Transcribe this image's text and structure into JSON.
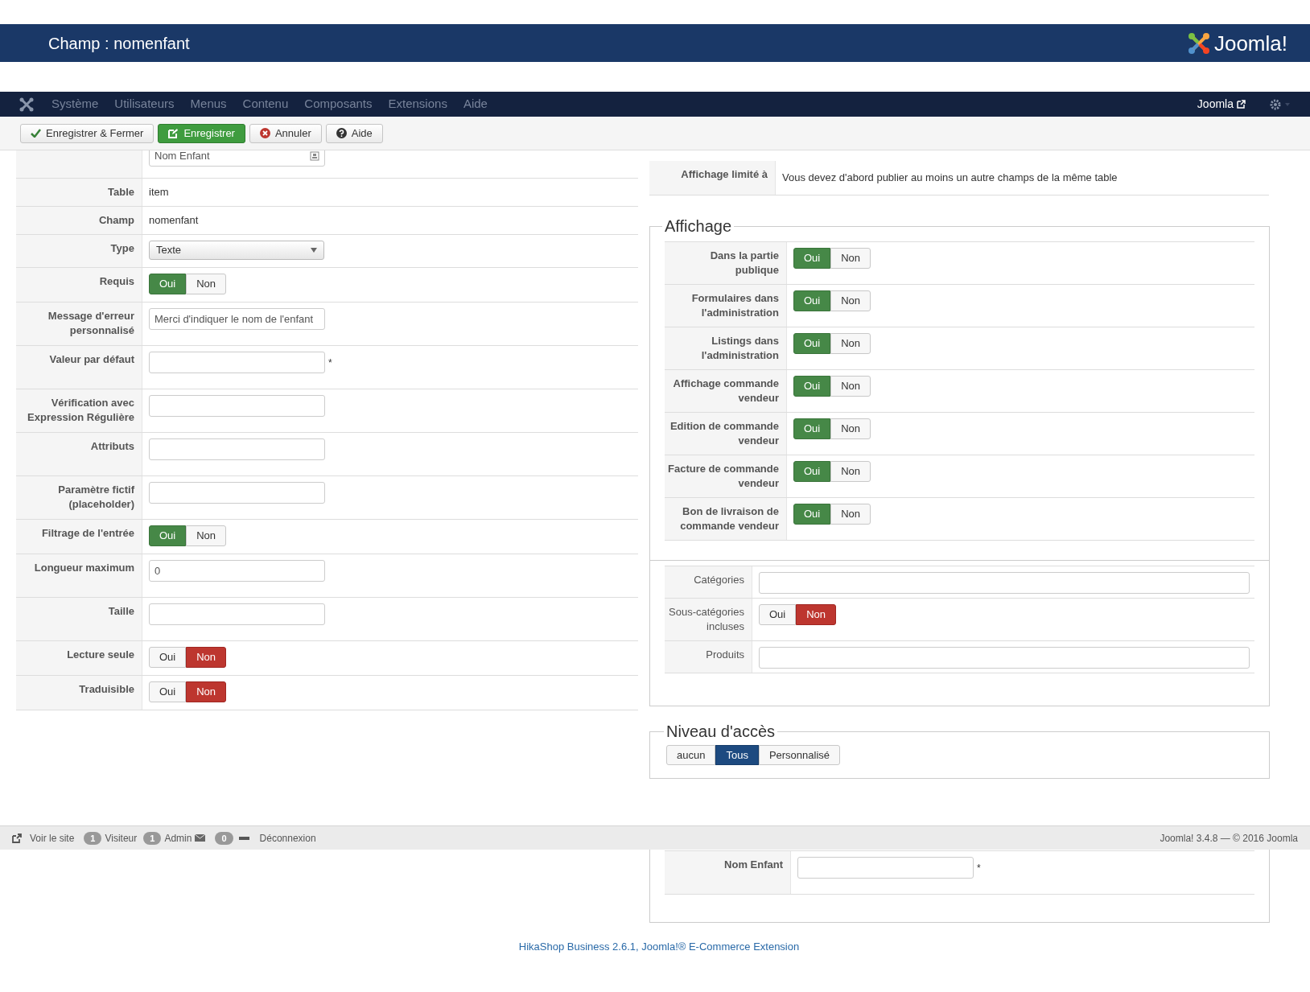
{
  "header": {
    "title": "Champ : nomenfant",
    "logo_text": "Joomla!"
  },
  "navbar": {
    "items": [
      "Système",
      "Utilisateurs",
      "Menus",
      "Contenu",
      "Composants",
      "Extensions",
      "Aide"
    ],
    "user_link": "Joomla"
  },
  "toolbar": [
    {
      "label": "Enregistrer & Fermer",
      "kind": "check"
    },
    {
      "label": "Enregistrer",
      "kind": "save"
    },
    {
      "label": "Annuler",
      "kind": "cancel"
    },
    {
      "label": "Aide",
      "kind": "help"
    }
  ],
  "left_form": [
    {
      "kind": "input_icon",
      "value": "Nom Enfant"
    },
    {
      "label": "Table",
      "kind": "text",
      "value": "item"
    },
    {
      "label": "Champ",
      "kind": "text",
      "value": "nomenfant"
    },
    {
      "label": "Type",
      "kind": "select",
      "value": "Texte"
    },
    {
      "label": "Requis",
      "kind": "toggle",
      "options": [
        {
          "label": "Oui",
          "selected": true
        },
        {
          "label": "Non",
          "selected": false
        }
      ]
    },
    {
      "label": "Message d'erreur personnalisé",
      "kind": "input",
      "value": "Merci d'indiquer le nom de l'enfant"
    },
    {
      "label": "Valeur par défaut",
      "kind": "input",
      "required_mark": "*"
    },
    {
      "label": "Vérification avec Expression Régulière",
      "kind": "input"
    },
    {
      "label": "Attributs",
      "kind": "input"
    },
    {
      "label": "Paramètre fictif (placeholder)",
      "kind": "input"
    },
    {
      "label": "Filtrage de l'entrée",
      "kind": "toggle",
      "options": [
        {
          "label": "Oui",
          "selected": true
        },
        {
          "label": "Non",
          "selected": false
        }
      ]
    },
    {
      "label": "Longueur maximum",
      "kind": "input",
      "value": "0"
    },
    {
      "label": "Taille",
      "kind": "input"
    },
    {
      "label": "Lecture seule",
      "kind": "toggle",
      "options": [
        {
          "label": "Oui",
          "selected": false
        },
        {
          "label": "Non",
          "selected": true
        }
      ]
    },
    {
      "label": "Traduisible",
      "kind": "toggle",
      "options": [
        {
          "label": "Oui",
          "selected": false
        },
        {
          "label": "Non",
          "selected": true
        }
      ]
    }
  ],
  "right_top": [
    {
      "label": "Affichage limité à",
      "kind": "text",
      "value": "Vous devez d'abord publier au moins un autre champs de la même table"
    }
  ],
  "affichage": {
    "legend": "Affichage",
    "rows": [
      {
        "label": "Dans la partie publique",
        "options": [
          {
            "label": "Oui",
            "selected": true
          },
          {
            "label": "Non",
            "selected": false
          }
        ]
      },
      {
        "label": "Formulaires dans l'administration",
        "options": [
          {
            "label": "Oui",
            "selected": true
          },
          {
            "label": "Non",
            "selected": false
          }
        ]
      },
      {
        "label": "Listings dans l'administration",
        "options": [
          {
            "label": "Oui",
            "selected": true
          },
          {
            "label": "Non",
            "selected": false
          }
        ]
      },
      {
        "label": "Affichage commande vendeur",
        "options": [
          {
            "label": "Oui",
            "selected": true
          },
          {
            "label": "Non",
            "selected": false
          }
        ]
      },
      {
        "label": "Edition de commande vendeur",
        "options": [
          {
            "label": "Oui",
            "selected": true
          },
          {
            "label": "Non",
            "selected": false
          }
        ]
      },
      {
        "label": "Facture de commande vendeur",
        "options": [
          {
            "label": "Oui",
            "selected": true
          },
          {
            "label": "Non",
            "selected": false
          }
        ]
      },
      {
        "label": "Bon de livraison de commande vendeur",
        "options": [
          {
            "label": "Oui",
            "selected": true
          },
          {
            "label": "Non",
            "selected": false
          }
        ]
      }
    ]
  },
  "categories": [
    {
      "label": "Catégories",
      "kind": "input"
    },
    {
      "label": "Sous-catégories incluses",
      "kind": "toggle",
      "options": [
        {
          "label": "Oui",
          "selected": false
        },
        {
          "label": "Non",
          "selected": true
        }
      ]
    },
    {
      "label": "Produits",
      "kind": "input"
    }
  ],
  "access": {
    "legend": "Niveau d'accès",
    "options": [
      {
        "label": "aucun",
        "selected": false
      },
      {
        "label": "Tous",
        "selected": true
      },
      {
        "label": "Personnalisé",
        "selected": false
      }
    ]
  },
  "status_bar": {
    "view_site": "Voir le site",
    "visitors_count": "1",
    "visitors": "Visiteur",
    "admins_count": "1",
    "admins": "Admin",
    "messages_count": "0",
    "logout": "Déconnexion",
    "version": "Joomla! 3.4.8 — © 2016 Joomla"
  },
  "custom_fields": [
    {
      "label": "Nom Enfant",
      "required_mark": "*"
    }
  ],
  "footer": "HikaShop Business 2.6.1, Joomla!® E-Commerce Extension"
}
